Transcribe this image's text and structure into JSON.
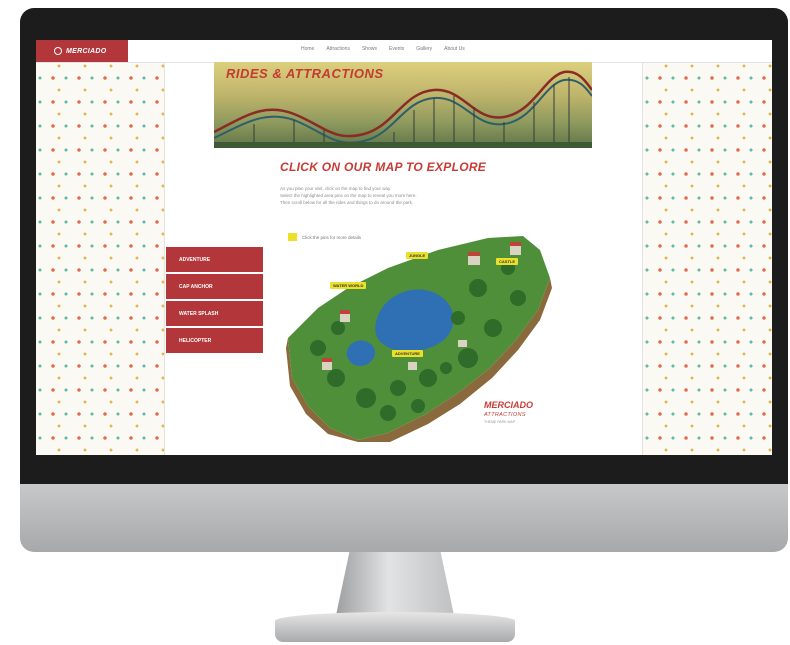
{
  "brand": {
    "logo_text": "MERCIADO",
    "logo_icon": "ring-logo-icon"
  },
  "nav": [
    "Home",
    "Attractions",
    "Shows",
    "Events",
    "Gallery",
    "About Us"
  ],
  "banner": {
    "title": "RIDES & ATTRACTIONS"
  },
  "main": {
    "heading": "CLICK ON OUR MAP TO EXPLORE",
    "intro_lines": [
      "As you plan your visit, click on the map to find your way.",
      "Select the highlighted area pins on the map to reveal you more here.",
      "Then scroll below for all the rides and things to do around the park."
    ],
    "legend_text": "Click the pins for more details"
  },
  "menu": [
    "ADVENTURE",
    "CAP ANCHOR",
    "WATER SPLASH",
    "HELICOPTER"
  ],
  "map_labels": [
    "JUNGLE",
    "CASTLE",
    "WATER WORLD",
    "ADVENTURE"
  ],
  "map_brand": {
    "title": "MERCIADO",
    "subtitle": "ATTRACTIONS",
    "small": "THEME PARK MAP"
  },
  "colors": {
    "brand_red": "#b3363a",
    "pin_yellow": "#ece12a"
  }
}
